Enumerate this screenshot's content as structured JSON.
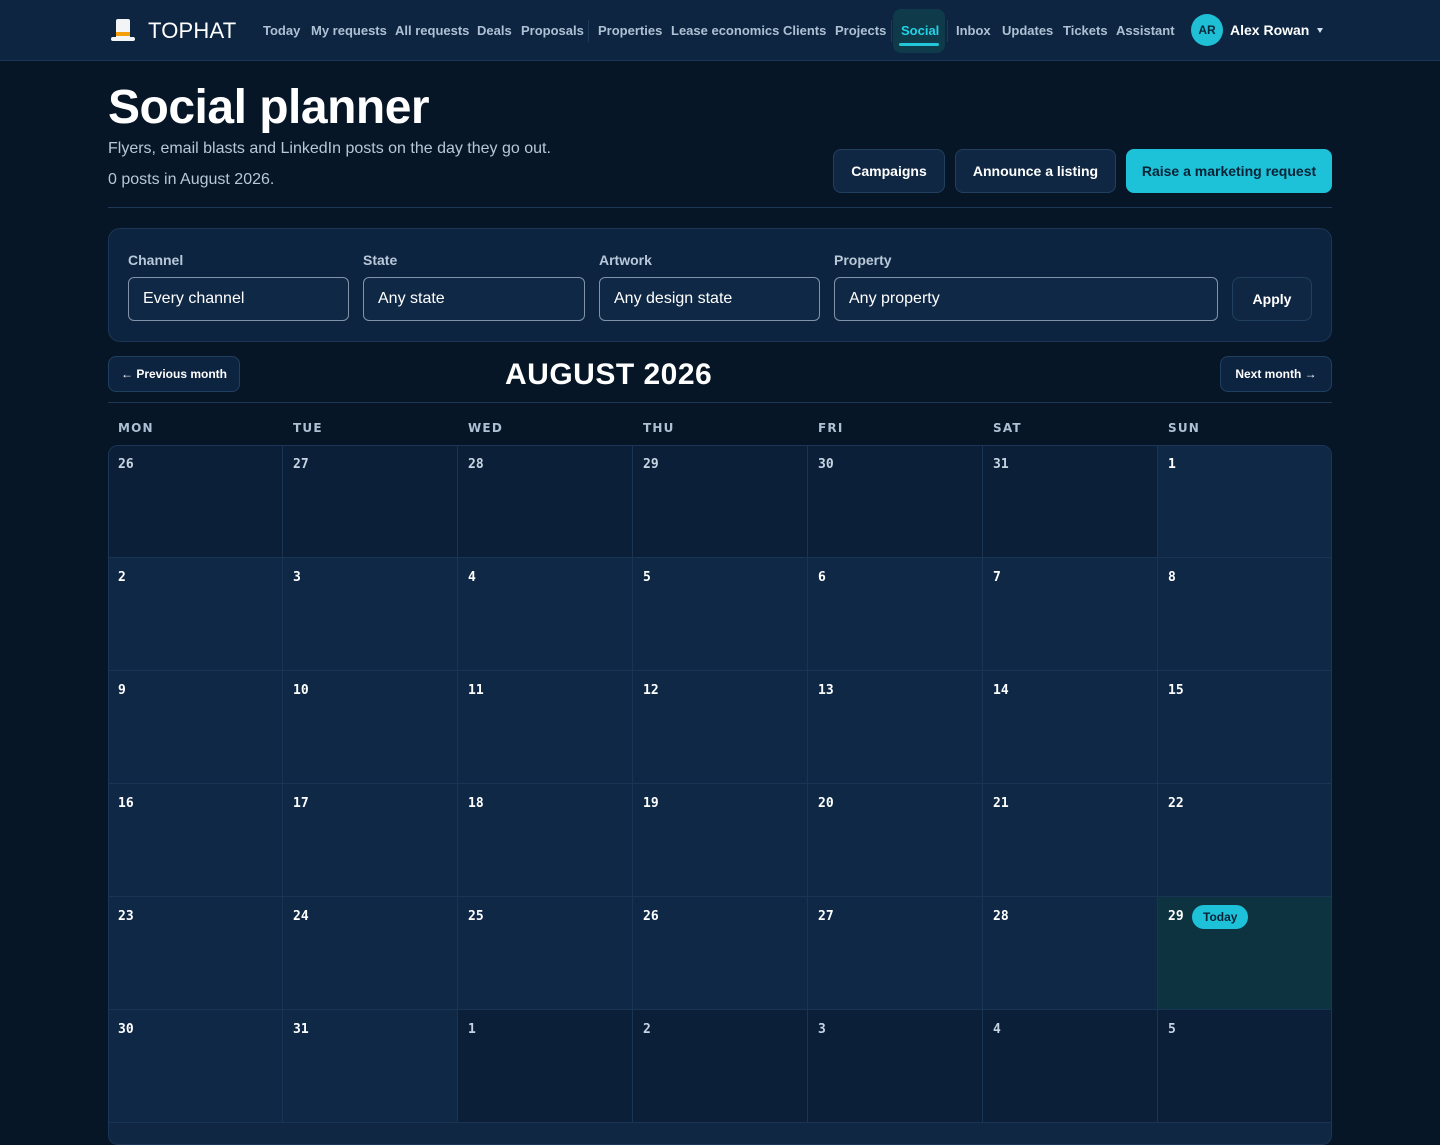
{
  "brand": {
    "name": "TOPHAT",
    "logo_icon": "tophat-logo-icon"
  },
  "nav": {
    "items": [
      {
        "label": "Today"
      },
      {
        "label": "My requests"
      },
      {
        "label": "All requests"
      },
      {
        "label": "Deals"
      },
      {
        "label": "Proposals"
      },
      {
        "label": "Properties"
      },
      {
        "label": "Lease economics"
      },
      {
        "label": "Clients"
      },
      {
        "label": "Projects"
      },
      {
        "label": "Social",
        "active": true
      },
      {
        "label": "Inbox"
      },
      {
        "label": "Updates"
      },
      {
        "label": "Tickets"
      },
      {
        "label": "Assistant"
      }
    ],
    "active": "Social"
  },
  "user": {
    "initials": "AR",
    "name": "Alex Rowan"
  },
  "header": {
    "title": "Social planner",
    "subtitle": "Flyers, email blasts and LinkedIn posts on the day they go out.",
    "post_count": "0 posts in August 2026.",
    "buttons": {
      "campaigns": "Campaigns",
      "announce": "Announce a listing",
      "raise": "Raise a marketing request"
    }
  },
  "filters": {
    "channel": {
      "label": "Channel",
      "value": "Every channel"
    },
    "state": {
      "label": "State",
      "value": "Any state"
    },
    "artwork": {
      "label": "Artwork",
      "value": "Any design state"
    },
    "property": {
      "label": "Property",
      "value": "Any property"
    },
    "apply": "Apply"
  },
  "calendar": {
    "prev": "← Previous month",
    "next": "Next month →",
    "month_title": "AUGUST 2026",
    "weekdays": [
      "MON",
      "TUE",
      "WED",
      "THU",
      "FRI",
      "SAT",
      "SUN"
    ],
    "today_label": "Today",
    "weeks": [
      [
        {
          "d": "26",
          "other": true
        },
        {
          "d": "27",
          "other": true
        },
        {
          "d": "28",
          "other": true
        },
        {
          "d": "29",
          "other": true
        },
        {
          "d": "30",
          "other": true
        },
        {
          "d": "31",
          "other": true
        },
        {
          "d": "1"
        }
      ],
      [
        {
          "d": "2"
        },
        {
          "d": "3"
        },
        {
          "d": "4"
        },
        {
          "d": "5"
        },
        {
          "d": "6"
        },
        {
          "d": "7"
        },
        {
          "d": "8"
        }
      ],
      [
        {
          "d": "9"
        },
        {
          "d": "10"
        },
        {
          "d": "11"
        },
        {
          "d": "12"
        },
        {
          "d": "13"
        },
        {
          "d": "14"
        },
        {
          "d": "15"
        }
      ],
      [
        {
          "d": "16"
        },
        {
          "d": "17"
        },
        {
          "d": "18"
        },
        {
          "d": "19"
        },
        {
          "d": "20"
        },
        {
          "d": "21"
        },
        {
          "d": "22"
        }
      ],
      [
        {
          "d": "23"
        },
        {
          "d": "24"
        },
        {
          "d": "25"
        },
        {
          "d": "26"
        },
        {
          "d": "27"
        },
        {
          "d": "28"
        },
        {
          "d": "29",
          "today": true
        }
      ],
      [
        {
          "d": "30"
        },
        {
          "d": "31"
        },
        {
          "d": "1",
          "other": true
        },
        {
          "d": "2",
          "other": true
        },
        {
          "d": "3",
          "other": true
        },
        {
          "d": "4",
          "other": true
        },
        {
          "d": "5",
          "other": true
        }
      ]
    ]
  },
  "colors": {
    "accent": "#1ec2d8",
    "background": "#061626",
    "surface": "#0f2845"
  }
}
